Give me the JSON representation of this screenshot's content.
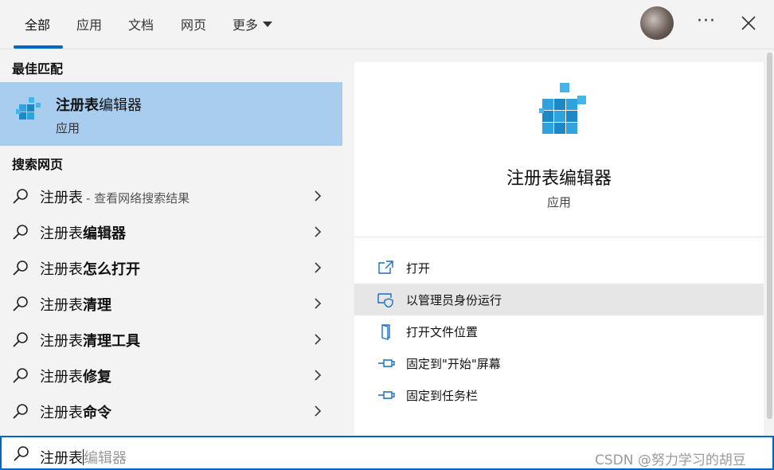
{
  "tabs": [
    {
      "label": "全部"
    },
    {
      "label": "应用"
    },
    {
      "label": "文档"
    },
    {
      "label": "网页"
    },
    {
      "label": "更多"
    }
  ],
  "best_match": {
    "heading": "最佳匹配",
    "name_bold": "注册表",
    "name_rest": "编辑器",
    "type": "应用"
  },
  "web_search": {
    "heading": "搜索网页",
    "items": [
      {
        "plain": "注册表",
        "bold": "",
        "sub": "- 查看网络搜索结果"
      },
      {
        "plain": "注册表",
        "bold": "编辑器",
        "sub": ""
      },
      {
        "plain": "注册表",
        "bold": "怎么打开",
        "sub": ""
      },
      {
        "plain": "注册表",
        "bold": "清理",
        "sub": ""
      },
      {
        "plain": "注册表",
        "bold": "清理工具",
        "sub": ""
      },
      {
        "plain": "注册表",
        "bold": "修复",
        "sub": ""
      },
      {
        "plain": "注册表",
        "bold": "命令",
        "sub": ""
      }
    ]
  },
  "detail": {
    "title": "注册表编辑器",
    "type": "应用",
    "actions": [
      {
        "label": "打开",
        "icon": "open-icon"
      },
      {
        "label": "以管理员身份运行",
        "icon": "shield-icon"
      },
      {
        "label": "打开文件位置",
        "icon": "file-location-icon"
      },
      {
        "label": "固定到\"开始\"屏幕",
        "icon": "pin-icon"
      },
      {
        "label": "固定到任务栏",
        "icon": "pin-icon"
      }
    ]
  },
  "search": {
    "typed": "注册表",
    "suggestion": "编辑器"
  },
  "watermark": "CSDN @努力学习的胡豆",
  "colors": {
    "accent": "#0067c0",
    "selected_bg": "#a9cdee",
    "hover_bg": "#e6e6e6",
    "regedit_cube": "#2ea3dd"
  }
}
